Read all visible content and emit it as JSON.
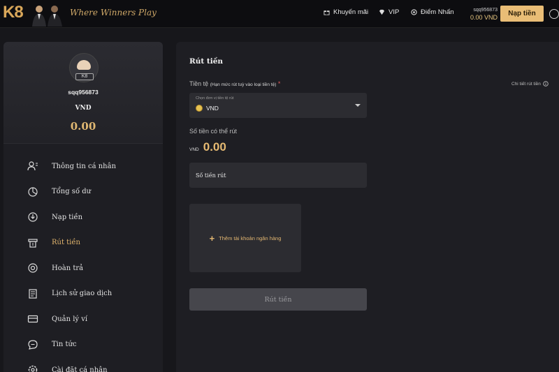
{
  "header": {
    "logo": "K8",
    "slogan": "Where Winners Play",
    "nav": [
      {
        "label": "Khuyến mãi",
        "icon": "gift-icon"
      },
      {
        "label": "VIP",
        "icon": "diamond-icon"
      },
      {
        "label": "Điểm Nhấn",
        "icon": "star-icon"
      }
    ],
    "account": {
      "username": "sqq956873",
      "balance": "0.00 VND"
    },
    "deposit_label": "Nạp tiền"
  },
  "sidebar": {
    "avatar_tag": "K8",
    "username": "sqq956873",
    "currency": "VND",
    "balance": "0.00",
    "items": [
      {
        "label": "Thông tin cá nhân",
        "icon": "user-list-icon"
      },
      {
        "label": "Tổng số dư",
        "icon": "pie-chart-icon"
      },
      {
        "label": "Nạp tiền",
        "icon": "deposit-icon"
      },
      {
        "label": "Rút tiền",
        "icon": "withdraw-icon",
        "active": true
      },
      {
        "label": "Hoàn trả",
        "icon": "rebate-icon"
      },
      {
        "label": "Lịch sử giao dịch",
        "icon": "history-icon"
      },
      {
        "label": "Quản lý ví",
        "icon": "wallet-icon"
      },
      {
        "label": "Tin tức",
        "icon": "chat-icon"
      },
      {
        "label": "Cài đặt cá nhân",
        "icon": "settings-icon"
      }
    ]
  },
  "withdraw": {
    "title": "Rút tiền",
    "currency_label": "Tiền tệ",
    "currency_note": "(Hạn mức rút tuỳ vào loại tiền tệ)",
    "required_mark": "*",
    "detail_link": "Chi tiết rút tiền",
    "select_placeholder": "Chọn đơn vị tiền tệ rút",
    "select_value": "VND",
    "available_label": "Số tiền có thể rút",
    "available_currency": "VND",
    "available_amount": "0.00",
    "amount_placeholder": "Số tiền rút",
    "add_bank_label": "Thêm tài khoản ngân hàng",
    "submit_label": "Rút tiền"
  },
  "colors": {
    "accent": "#e2b56d",
    "background": "#17171b",
    "panel": "#1e1e23",
    "field": "#2c2c31"
  }
}
